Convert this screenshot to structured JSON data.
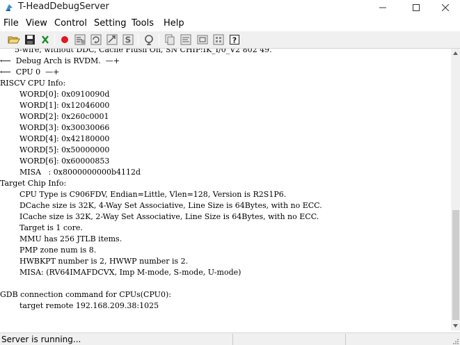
{
  "window": {
    "title": "T-HeadDebugServer",
    "icon": "app-icon",
    "controls": [
      "minimize-icon",
      "maximize-icon",
      "close-icon"
    ]
  },
  "menu": {
    "items": [
      "File",
      "View",
      "Control",
      "Setting",
      "Tools",
      "Help"
    ]
  },
  "toolbar": {
    "buttons": [
      "open-icon",
      "save-icon",
      "cancel-icon",
      "record-icon",
      "reset-icon",
      "refresh-icon",
      "dump-icon",
      "download-icon",
      "target-icon",
      "copy-icon",
      "log-icon",
      "terminal-icon",
      "config-icon",
      "help-icon"
    ],
    "accent_red": "#e0191e",
    "accent_green": "#1a8f2a"
  },
  "console": {
    "lines": [
      "      5-wire, without DDC, Cache Flush On, SN CHIP:IK_I/0_V2 802 49.",
      "⟵  Debug Arch is RVDM.  —+",
      "⟵  CPU 0  —+",
      "RISCV CPU Info:",
      "        WORD[0]: 0x0910090d",
      "        WORD[1]: 0x12046000",
      "        WORD[2]: 0x260c0001",
      "        WORD[3]: 0x30030066",
      "        WORD[4]: 0x42180000",
      "        WORD[5]: 0x50000000",
      "        WORD[6]: 0x60000853",
      "        MISA   : 0x8000000000b4112d",
      "Target Chip Info:",
      "        CPU Type is C906FDV, Endian=Little, Vlen=128, Version is R2S1P6.",
      "        DCache size is 32K, 4-Way Set Associative, Line Size is 64Bytes, with no ECC.",
      "        ICache size is 32K, 2-Way Set Associative, Line Size is 64Bytes, with no ECC.",
      "        Target is 1 core.",
      "        MMU has 256 JTLB items.",
      "        PMP zone num is 8.",
      "        HWBKPT number is 2, HWWP number is 2.",
      "        MISA: (RV64IMAFDCVX, Imp M-mode, S-mode, U-mode)",
      "",
      "GDB connection command for CPUs(CPU0):",
      "        target remote 192.168.209.38:1025"
    ]
  },
  "status": {
    "text": "Server is running..."
  }
}
